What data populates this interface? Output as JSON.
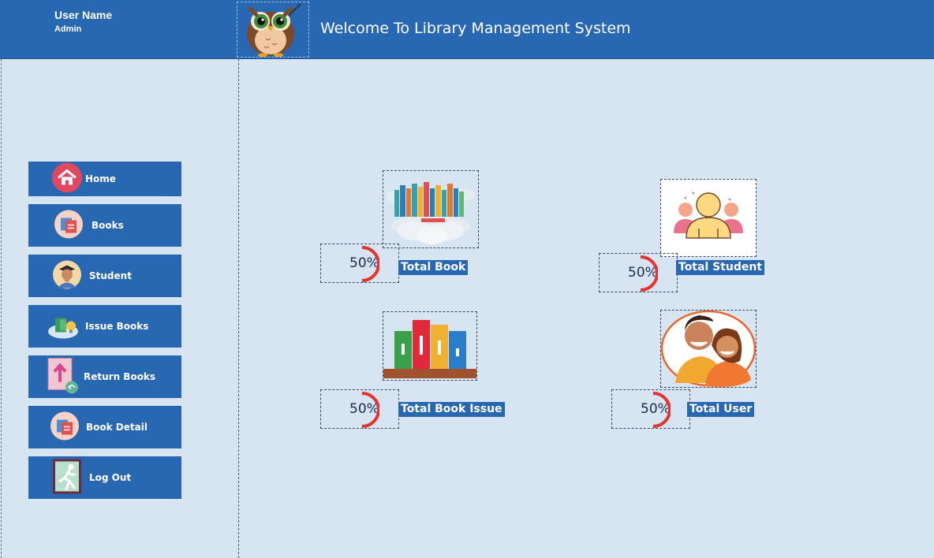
{
  "header": {
    "user_name": "User Name",
    "user_role": "Admin",
    "title": "Welcome To Library Management System",
    "logo_icon": "owl-icon"
  },
  "sidebar": {
    "items": [
      {
        "label": "Home",
        "icon": "home-icon"
      },
      {
        "label": "Books",
        "icon": "books-icon"
      },
      {
        "label": "Student",
        "icon": "student-icon"
      },
      {
        "label": "Issue Books",
        "icon": "issue-books-icon"
      },
      {
        "label": "Return Books",
        "icon": "return-books-icon"
      },
      {
        "label": "Book Detail",
        "icon": "book-detail-icon"
      },
      {
        "label": "Log Out",
        "icon": "logout-icon"
      }
    ]
  },
  "tiles": [
    {
      "label": "Total Book",
      "percent": "50%",
      "icon": "books-cloud-icon"
    },
    {
      "label": "Total Student",
      "percent": "50%",
      "icon": "students-icon"
    },
    {
      "label": "Total Book Issue",
      "percent": "50%",
      "icon": "bookshelf-icon"
    },
    {
      "label": "Total User",
      "percent": "50%",
      "icon": "users-icon"
    }
  ],
  "colors": {
    "accent": "#2867b2",
    "background": "#d7e4f1",
    "progress": "#e0362f"
  }
}
